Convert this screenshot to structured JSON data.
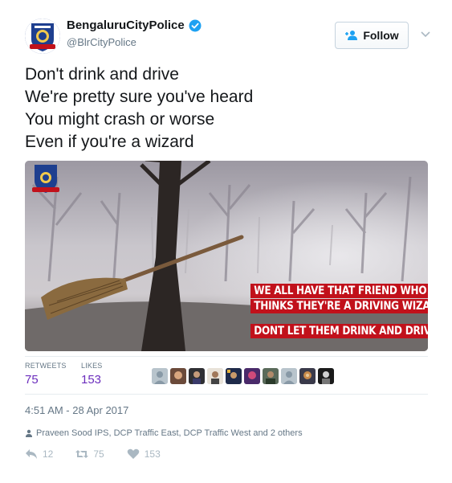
{
  "user": {
    "display_name": "BengaluruCityPolice",
    "handle": "@BlrCityPolice",
    "verified": true
  },
  "follow_label": "Follow",
  "tweet": {
    "lines": [
      "Don't drink and drive",
      "We're pretty sure you've heard",
      "You might crash or worse",
      "Even if you're a wizard"
    ]
  },
  "media": {
    "banner_line1": "WE ALL HAVE THAT FRIEND WHO",
    "banner_line2": "THINKS THEY'RE A DRIVING WIZARD",
    "banner_line3": "DONT LET THEM DRINK AND DRIVE.",
    "accent_color": "#c1111b"
  },
  "stats": {
    "retweets_label": "RETWEETS",
    "retweets_value": "75",
    "likes_label": "LIKES",
    "likes_value": "153",
    "value_color": "#6b2dbd"
  },
  "timestamp": "4:51 AM - 28 Apr 2017",
  "context_text": "Praveen Sood IPS, DCP Traffic East, DCP Traffic West and 2 others",
  "actions": {
    "reply_count": "12",
    "retweet_count": "75",
    "like_count": "153"
  }
}
